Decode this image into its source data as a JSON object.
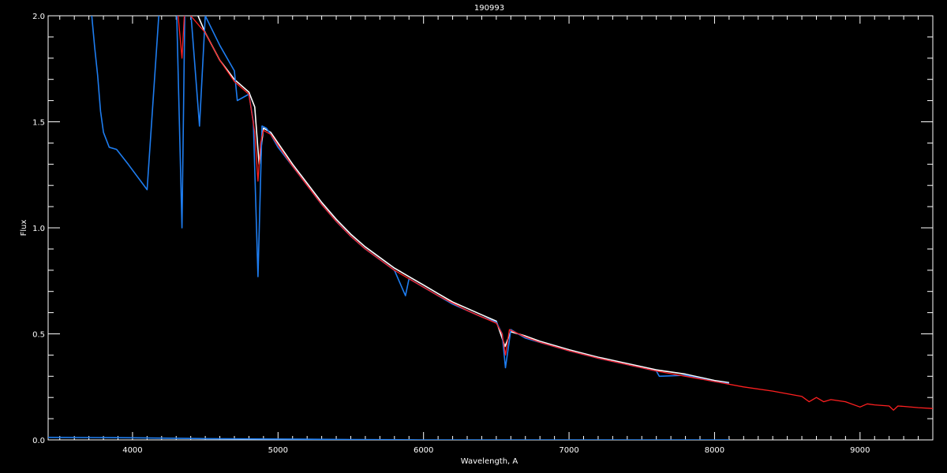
{
  "chart_data": {
    "type": "line",
    "title": "190993",
    "xlabel": "Wavelength, A",
    "ylabel": "Flux",
    "xlim": [
      3420,
      9500
    ],
    "ylim": [
      0,
      2
    ],
    "x_ticks": [
      4000,
      5000,
      6000,
      7000,
      8000,
      9000
    ],
    "y_ticks": [
      "0.0",
      "0.5",
      "1.0",
      "1.5",
      "2.0"
    ],
    "y_tick_values": [
      0,
      0.5,
      1,
      1.5,
      2
    ],
    "grid": false,
    "background": "#000000",
    "axis_color": "#ffffff",
    "series": [
      {
        "role": "observed",
        "color": "#ffffff",
        "x": [
          3420,
          3700,
          3800,
          3900,
          4000,
          4100,
          4200,
          4300,
          4350,
          4400,
          4450,
          4500,
          4600,
          4700,
          4800,
          4840,
          4870,
          4900,
          4950,
          5000,
          5100,
          5200,
          5300,
          5400,
          5500,
          5600,
          5700,
          5800,
          5900,
          6000,
          6100,
          6200,
          6300,
          6400,
          6500,
          6560,
          6600,
          6700,
          6800,
          6900,
          7000,
          7200,
          7400,
          7600,
          7800,
          8000,
          8100
        ],
        "y": [
          2.6,
          2.6,
          2.55,
          2.5,
          2.45,
          2.4,
          2.3,
          2.15,
          2.08,
          2.05,
          2.0,
          1.92,
          1.79,
          1.7,
          1.64,
          1.57,
          1.3,
          1.47,
          1.45,
          1.4,
          1.3,
          1.21,
          1.12,
          1.04,
          0.97,
          0.91,
          0.86,
          0.81,
          0.77,
          0.73,
          0.69,
          0.65,
          0.62,
          0.59,
          0.56,
          0.44,
          0.51,
          0.49,
          0.465,
          0.445,
          0.425,
          0.39,
          0.36,
          0.33,
          0.31,
          0.28,
          0.27
        ]
      },
      {
        "role": "observed-blue",
        "color": "#1e7df0",
        "x": [
          3420,
          3700,
          3720,
          3740,
          3760,
          3780,
          3800,
          3840,
          3890,
          3970,
          4100,
          4200,
          4300,
          4340,
          4360,
          4400,
          4460,
          4500,
          4600,
          4700,
          4720,
          4800,
          4830,
          4862,
          4890,
          4920,
          4950,
          5000,
          5100,
          5200,
          5300,
          5400,
          5500,
          5600,
          5700,
          5800,
          5876,
          5900,
          6000,
          6100,
          6200,
          6300,
          6400,
          6500,
          6540,
          6563,
          6600,
          6700,
          6800,
          6900,
          7000,
          7200,
          7400,
          7600,
          7620,
          7800,
          8000,
          8100
        ],
        "y": [
          2.6,
          2.6,
          2.0,
          1.85,
          1.72,
          1.55,
          1.45,
          1.38,
          1.37,
          1.3,
          1.18,
          2.2,
          2.1,
          1.0,
          2.05,
          2.02,
          1.48,
          2.0,
          1.86,
          1.74,
          1.6,
          1.63,
          1.5,
          0.77,
          1.48,
          1.47,
          1.44,
          1.38,
          1.29,
          1.2,
          1.11,
          1.03,
          0.96,
          0.9,
          0.85,
          0.8,
          0.68,
          0.76,
          0.72,
          0.68,
          0.64,
          0.61,
          0.58,
          0.555,
          0.5,
          0.34,
          0.52,
          0.48,
          0.46,
          0.44,
          0.42,
          0.385,
          0.355,
          0.325,
          0.3,
          0.305,
          0.275,
          0.265
        ]
      },
      {
        "role": "model",
        "color": "#ff2020",
        "x": [
          4300,
          4340,
          4360,
          4400,
          4450,
          4500,
          4600,
          4700,
          4800,
          4840,
          4862,
          4880,
          4900,
          4950,
          5000,
          5100,
          5200,
          5300,
          5400,
          5500,
          5600,
          5700,
          5800,
          5900,
          6000,
          6100,
          6200,
          6300,
          6400,
          6500,
          6540,
          6563,
          6590,
          6700,
          6800,
          6900,
          7000,
          7200,
          7400,
          7600,
          7800,
          8000,
          8200,
          8400,
          8600,
          8650,
          8700,
          8750,
          8800,
          8900,
          9000,
          9050,
          9100,
          9200,
          9230,
          9260,
          9300,
          9400,
          9500
        ],
        "y": [
          2.1,
          1.8,
          2.05,
          2.0,
          1.96,
          1.92,
          1.79,
          1.69,
          1.63,
          1.45,
          1.22,
          1.4,
          1.46,
          1.44,
          1.39,
          1.29,
          1.2,
          1.11,
          1.03,
          0.96,
          0.9,
          0.85,
          0.8,
          0.76,
          0.72,
          0.68,
          0.645,
          0.61,
          0.58,
          0.55,
          0.5,
          0.4,
          0.52,
          0.485,
          0.46,
          0.44,
          0.42,
          0.385,
          0.355,
          0.325,
          0.3,
          0.275,
          0.25,
          0.23,
          0.205,
          0.18,
          0.2,
          0.18,
          0.19,
          0.18,
          0.155,
          0.17,
          0.165,
          0.16,
          0.14,
          0.16,
          0.158,
          0.152,
          0.148
        ]
      },
      {
        "role": "error",
        "color": "#1e7df0",
        "x": [
          3420,
          4000,
          4500,
          5000,
          5500,
          6000,
          7000,
          8000,
          8100
        ],
        "y": [
          0.012,
          0.01,
          0.006,
          0.004,
          0.002,
          0.0,
          0.0,
          0.0,
          0.0
        ]
      }
    ]
  }
}
